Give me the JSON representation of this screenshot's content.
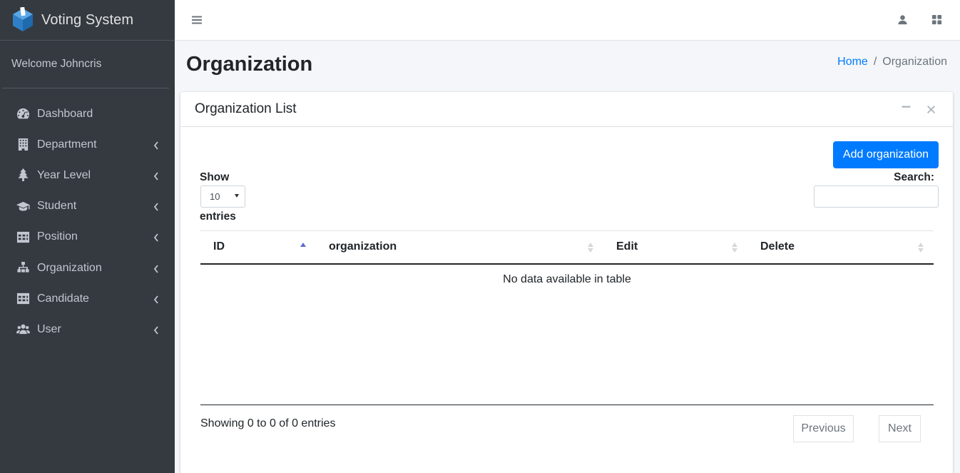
{
  "brand": {
    "name": "Voting System",
    "logo_color": "#3d8bd4"
  },
  "user_panel": {
    "welcome": "Welcome Johncris"
  },
  "sidebar": {
    "items": [
      {
        "label": "Dashboard",
        "icon": "dashboard-icon",
        "has_submenu": false
      },
      {
        "label": "Department",
        "icon": "building-icon",
        "has_submenu": true
      },
      {
        "label": "Year Level",
        "icon": "tree-icon",
        "has_submenu": true
      },
      {
        "label": "Student",
        "icon": "graduation-cap-icon",
        "has_submenu": true
      },
      {
        "label": "Position",
        "icon": "table-icon",
        "has_submenu": true
      },
      {
        "label": "Organization",
        "icon": "sitemap-icon",
        "has_submenu": true
      },
      {
        "label": "Candidate",
        "icon": "table-icon",
        "has_submenu": true
      },
      {
        "label": "User",
        "icon": "users-icon",
        "has_submenu": true
      }
    ]
  },
  "topnav": {
    "menu_icon": "bars-icon",
    "user_icon": "user-icon",
    "apps_icon": "grid-icon"
  },
  "header": {
    "title": "Organization",
    "breadcrumb": {
      "home": "Home",
      "separator": "/",
      "current": "Organization"
    }
  },
  "card": {
    "title": "Organization List",
    "add_button": "Add organization",
    "length": {
      "show": "Show",
      "value": "10",
      "entries": "entries"
    },
    "search": {
      "label": "Search:",
      "value": ""
    },
    "table": {
      "columns": [
        "ID",
        "organization",
        "Edit",
        "Delete"
      ],
      "empty_message": "No data available in table"
    },
    "info": "Showing 0 to 0 of 0 entries",
    "pagination": {
      "previous": "Previous",
      "next": "Next"
    }
  },
  "colors": {
    "sidebar_bg": "#343a40",
    "primary": "#007bff",
    "page_bg": "#f4f6f9"
  }
}
